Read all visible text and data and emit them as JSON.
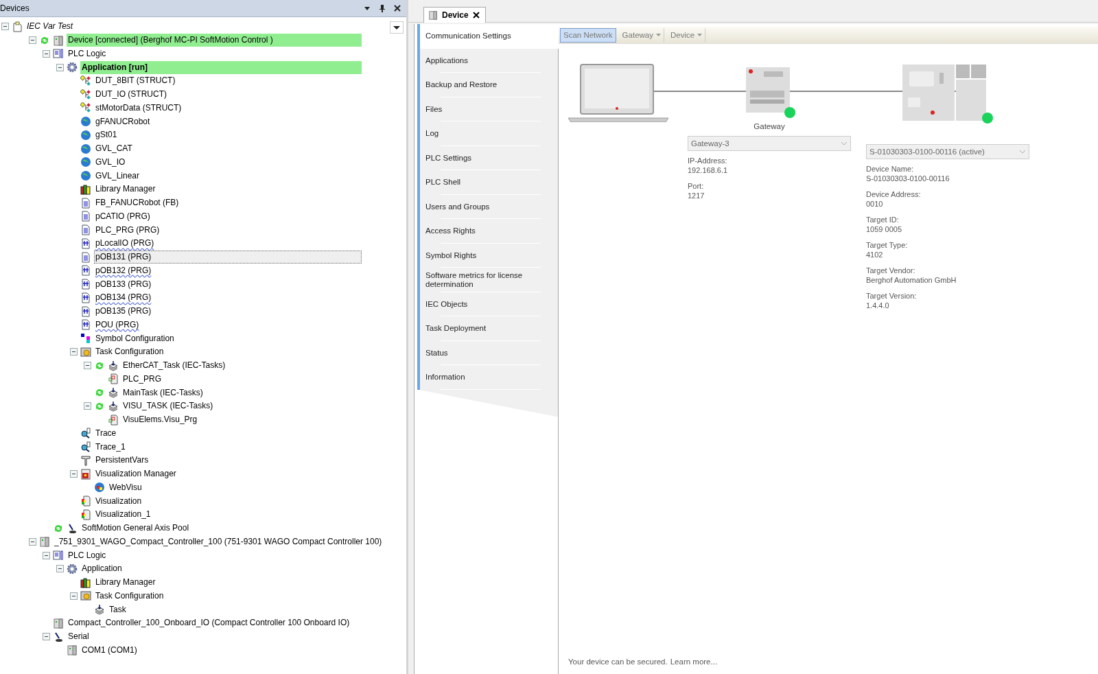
{
  "devices_panel": {
    "title": "Devices",
    "project": {
      "label": "IEC Var Test",
      "expanded": true
    },
    "tree": [
      {
        "label": "Device [connected] (Berghof MC-PI SoftMotion Control )",
        "kind": "device",
        "online": true,
        "active": true,
        "selected": false,
        "expanded": true,
        "children": [
          {
            "label": "PLC Logic",
            "kind": "plc-logic",
            "active": false,
            "selected": false,
            "expanded": true,
            "children": [
              {
                "label": "Application [run]",
                "kind": "application",
                "active": true,
                "selected": false,
                "expanded": true,
                "children": [
                  {
                    "label": "DUT_8BIT (STRUCT)",
                    "kind": "struct",
                    "active": false,
                    "selected": false
                  },
                  {
                    "label": "DUT_IO (STRUCT)",
                    "kind": "struct",
                    "active": false,
                    "selected": false
                  },
                  {
                    "label": "stMotorData (STRUCT)",
                    "kind": "struct",
                    "active": false,
                    "selected": false
                  },
                  {
                    "label": "gFANUCRobot",
                    "kind": "gvl",
                    "active": false,
                    "selected": false
                  },
                  {
                    "label": "gSt01",
                    "kind": "gvl",
                    "active": false,
                    "selected": false
                  },
                  {
                    "label": "GVL_CAT",
                    "kind": "gvl",
                    "active": false,
                    "selected": false
                  },
                  {
                    "label": "GVL_IO",
                    "kind": "gvl",
                    "active": false,
                    "selected": false
                  },
                  {
                    "label": "GVL_Linear",
                    "kind": "gvl",
                    "active": false,
                    "selected": false
                  },
                  {
                    "label": "Library Manager",
                    "kind": "library",
                    "active": false,
                    "selected": false
                  },
                  {
                    "label": "FB_FANUCRobot (FB)",
                    "kind": "pou",
                    "active": false,
                    "selected": false
                  },
                  {
                    "label": "pCATIO (PRG)",
                    "kind": "pou",
                    "active": false,
                    "selected": false
                  },
                  {
                    "label": "PLC_PRG (PRG)",
                    "kind": "pou",
                    "active": false,
                    "selected": false
                  },
                  {
                    "label": "pLocalIO (PRG)",
                    "kind": "pou-ld",
                    "active": false,
                    "selected": false,
                    "flagged": true
                  },
                  {
                    "label": "pOB131 (PRG)",
                    "kind": "pou",
                    "active": false,
                    "selected": true
                  },
                  {
                    "label": "pOB132 (PRG)",
                    "kind": "pou-ld",
                    "active": false,
                    "selected": false,
                    "flagged": true
                  },
                  {
                    "label": "pOB133 (PRG)",
                    "kind": "pou-ld",
                    "active": false,
                    "selected": false
                  },
                  {
                    "label": "pOB134 (PRG)",
                    "kind": "pou-ld",
                    "active": false,
                    "selected": false,
                    "flagged": true
                  },
                  {
                    "label": "pOB135 (PRG)",
                    "kind": "pou-ld",
                    "active": false,
                    "selected": false
                  },
                  {
                    "label": "POU (PRG)",
                    "kind": "pou-ld",
                    "active": false,
                    "selected": false,
                    "flagged": true
                  },
                  {
                    "label": "Symbol Configuration",
                    "kind": "symbol",
                    "active": false,
                    "selected": false
                  },
                  {
                    "label": "Task Configuration",
                    "kind": "taskconfig",
                    "active": false,
                    "selected": false,
                    "expanded": true,
                    "children": [
                      {
                        "label": "EtherCAT_Task (IEC-Tasks)",
                        "kind": "task",
                        "online": true,
                        "active": false,
                        "selected": false,
                        "expanded": true,
                        "children": [
                          {
                            "label": "PLC_PRG",
                            "kind": "call",
                            "active": false,
                            "selected": false
                          }
                        ]
                      },
                      {
                        "label": "MainTask (IEC-Tasks)",
                        "kind": "task",
                        "online": true,
                        "active": false,
                        "selected": false
                      },
                      {
                        "label": "VISU_TASK (IEC-Tasks)",
                        "kind": "task",
                        "online": true,
                        "active": false,
                        "selected": false,
                        "expanded": true,
                        "children": [
                          {
                            "label": "VisuElems.Visu_Prg",
                            "kind": "call",
                            "active": false,
                            "selected": false
                          }
                        ]
                      }
                    ]
                  },
                  {
                    "label": "Trace",
                    "kind": "trace",
                    "active": false,
                    "selected": false
                  },
                  {
                    "label": "Trace_1",
                    "kind": "trace",
                    "active": false,
                    "selected": false
                  },
                  {
                    "label": "PersistentVars",
                    "kind": "persistent",
                    "active": false,
                    "selected": false
                  },
                  {
                    "label": "Visualization Manager",
                    "kind": "visu-manager",
                    "active": false,
                    "selected": false,
                    "expanded": true,
                    "children": [
                      {
                        "label": "WebVisu",
                        "kind": "webvisu",
                        "active": false,
                        "selected": false
                      }
                    ]
                  },
                  {
                    "label": "Visualization",
                    "kind": "visu",
                    "active": false,
                    "selected": false
                  },
                  {
                    "label": "Visualization_1",
                    "kind": "visu",
                    "active": false,
                    "selected": false
                  }
                ]
              }
            ]
          },
          {
            "label": "SoftMotion General Axis Pool",
            "kind": "axis-pool",
            "online": true,
            "active": false,
            "selected": false
          }
        ]
      },
      {
        "label": "_751_9301_WAGO_Compact_Controller_100 (751-9301 WAGO Compact Controller 100)",
        "kind": "device",
        "active": false,
        "selected": false,
        "expanded": true,
        "children": [
          {
            "label": "PLC Logic",
            "kind": "plc-logic",
            "active": false,
            "selected": false,
            "expanded": true,
            "children": [
              {
                "label": "Application",
                "kind": "application",
                "active": false,
                "selected": false,
                "expanded": true,
                "children": [
                  {
                    "label": "Library Manager",
                    "kind": "library",
                    "active": false,
                    "selected": false
                  },
                  {
                    "label": "Task Configuration",
                    "kind": "taskconfig",
                    "active": false,
                    "selected": false,
                    "expanded": true,
                    "children": [
                      {
                        "label": "Task",
                        "kind": "task",
                        "active": false,
                        "selected": false
                      }
                    ]
                  }
                ]
              }
            ]
          },
          {
            "label": "Compact_Controller_100_Onboard_IO (Compact Controller 100 Onboard IO)",
            "kind": "device",
            "active": false,
            "selected": false
          },
          {
            "label": "Serial",
            "kind": "serial",
            "active": false,
            "selected": false,
            "expanded": true,
            "children": [
              {
                "label": "COM1 (COM1)",
                "kind": "device",
                "active": false,
                "selected": false
              }
            ]
          }
        ]
      }
    ]
  },
  "editor_tab": {
    "label": "Device",
    "selected": true
  },
  "settings_nav": [
    {
      "label": "Communication Settings",
      "selected": true
    },
    {
      "label": "Applications",
      "selected": false
    },
    {
      "label": "Backup and Restore",
      "selected": false
    },
    {
      "label": "Files",
      "selected": false
    },
    {
      "label": "Log",
      "selected": false
    },
    {
      "label": "PLC Settings",
      "selected": false
    },
    {
      "label": "PLC Shell",
      "selected": false
    },
    {
      "label": "Users and Groups",
      "selected": false
    },
    {
      "label": "Access Rights",
      "selected": false
    },
    {
      "label": "Symbol Rights",
      "selected": false
    },
    {
      "label": "Software metrics for license determination",
      "selected": false
    },
    {
      "label": "IEC Objects",
      "selected": false
    },
    {
      "label": "Task Deployment",
      "selected": false
    },
    {
      "label": "Status",
      "selected": false
    },
    {
      "label": "Information",
      "selected": false
    }
  ],
  "toolbar": [
    {
      "label": "Scan Network",
      "kind": "button",
      "selected": true
    },
    {
      "label": "Gateway",
      "kind": "dropdown",
      "selected": false
    },
    {
      "label": "Device",
      "kind": "dropdown",
      "selected": false
    }
  ],
  "gateway": {
    "label": "Gateway",
    "online": true,
    "select": "Gateway-3",
    "fields": [
      {
        "label": "IP-Address:",
        "value": "192.168.6.1"
      },
      {
        "label": "Port:",
        "value": "1217"
      }
    ]
  },
  "device": {
    "online": true,
    "select": "S-01030303-0100-00116 (active)",
    "fields": [
      {
        "label": "Device Name:",
        "value": "S-01030303-0100-00116"
      },
      {
        "label": "Device Address:",
        "value": "0010"
      },
      {
        "label": "Target ID:",
        "value": "1059  0005"
      },
      {
        "label": "Target Type:",
        "value": "4102"
      },
      {
        "label": "Target Vendor:",
        "value": "Berghof Automation GmbH"
      },
      {
        "label": "Target Version:",
        "value": "1.4.4.0"
      }
    ]
  },
  "footer": {
    "text": "Your device can be secured.",
    "link": "Learn more..."
  }
}
